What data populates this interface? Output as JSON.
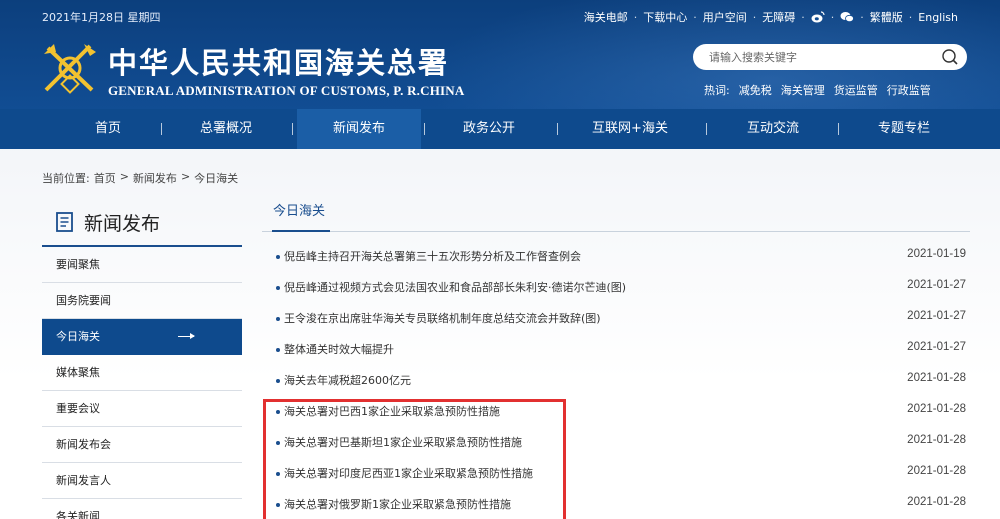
{
  "header": {
    "date": "2021年1月28日 星期四",
    "top_links": [
      "海关电邮",
      "下载中心",
      "用户空间",
      "无障碍"
    ],
    "icons": [
      "weibo-icon",
      "wechat-icon"
    ],
    "lang_traditional": "繁體版",
    "lang_english": "English",
    "title_cn": "中华人民共和国海关总署",
    "title_en": "GENERAL ADMINISTRATION OF CUSTOMS, P. R.CHINA",
    "search_placeholder": "请输入搜索关键字",
    "hot_label": "热词:",
    "hot_words": [
      "减免税",
      "海关管理",
      "货运监管",
      "行政监管"
    ]
  },
  "nav": {
    "items": [
      "首页",
      "总署概况",
      "新闻发布",
      "政务公开",
      "互联网+海关",
      "互动交流",
      "专题专栏"
    ],
    "active_index": 2
  },
  "breadcrumb": {
    "prefix": "当前位置:",
    "items": [
      "首页",
      "新闻发布",
      "今日海关"
    ],
    "separator": ">"
  },
  "sidebar": {
    "title": "新闻发布",
    "items": [
      "要闻聚焦",
      "国务院要闻",
      "今日海关",
      "媒体聚焦",
      "重要会议",
      "新闻发布会",
      "新闻发言人",
      "各关新闻"
    ],
    "active_index": 2
  },
  "main": {
    "title": "今日海关",
    "news": [
      {
        "title": "倪岳峰主持召开海关总署第三十五次形势分析及工作督查例会",
        "date": "2021-01-19"
      },
      {
        "title": "倪岳峰通过视频方式会见法国农业和食品部部长朱利安·德诺尔芒迪(图)",
        "date": "2021-01-27"
      },
      {
        "title": "王令浚在京出席驻华海关专员联络机制年度总结交流会并致辞(图)",
        "date": "2021-01-27"
      },
      {
        "title": "整体通关时效大幅提升",
        "date": "2021-01-27"
      },
      {
        "title": "海关去年减税超2600亿元",
        "date": "2021-01-28"
      },
      {
        "title": "海关总署对巴西1家企业采取紧急预防性措施",
        "date": "2021-01-28"
      },
      {
        "title": "海关总署对巴基斯坦1家企业采取紧急预防性措施",
        "date": "2021-01-28"
      },
      {
        "title": "海关总署对印度尼西亚1家企业采取紧急预防性措施",
        "date": "2021-01-28"
      },
      {
        "title": "海关总署对俄罗斯1家企业采取紧急预防性措施",
        "date": "2021-01-28"
      }
    ]
  },
  "colors": {
    "header_blue": "#0c3f7d",
    "nav_blue": "#0e4a8d",
    "nav_active": "#1b5ea6",
    "highlight_red": "#e23030"
  }
}
